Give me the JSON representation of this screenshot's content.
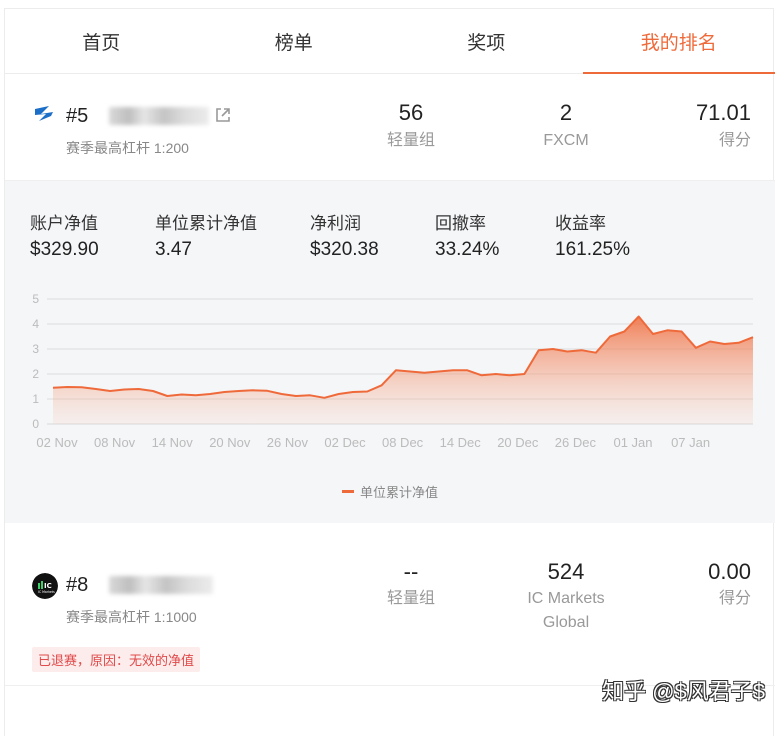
{
  "tabs": [
    "首页",
    "榜单",
    "奖项",
    "我的排名"
  ],
  "entries": [
    {
      "rank": "#5",
      "leverage": "赛季最高杠杆 1:200",
      "stats": [
        {
          "value": "56",
          "label": "轻量组"
        },
        {
          "value": "2",
          "label": "FXCM"
        },
        {
          "value": "71.01",
          "label": "得分"
        }
      ]
    },
    {
      "rank": "#8",
      "leverage": "赛季最高杠杆 1:1000",
      "stats": [
        {
          "value": "--",
          "label": "轻量组"
        },
        {
          "value": "524",
          "label": "IC Markets\nGlobal"
        },
        {
          "value": "0.00",
          "label": "得分"
        }
      ],
      "status_badge": "已退赛，原因：无效的净值",
      "logo_text": "IC Markets"
    }
  ],
  "metrics": [
    {
      "label": "账户净值",
      "value": "$329.90"
    },
    {
      "label": "单位累计净值",
      "value": "3.47"
    },
    {
      "label": "净利润",
      "value": "$320.38"
    },
    {
      "label": "回撤率",
      "value": "33.24%"
    },
    {
      "label": "收益率",
      "value": "161.25%"
    }
  ],
  "chart_data": {
    "type": "area",
    "x": [
      "02 Nov",
      "08 Nov",
      "14 Nov",
      "20 Nov",
      "26 Nov",
      "02 Dec",
      "08 Dec",
      "14 Dec",
      "20 Dec",
      "26 Dec",
      "01 Jan",
      "07 Jan"
    ],
    "ylim": [
      0,
      5
    ],
    "yticks": [
      0,
      1,
      2,
      3,
      4,
      5
    ],
    "series": [
      {
        "name": "单位累计净值",
        "values": [
          1.45,
          1.48,
          1.47,
          1.4,
          1.32,
          1.38,
          1.4,
          1.32,
          1.12,
          1.18,
          1.15,
          1.2,
          1.28,
          1.32,
          1.35,
          1.33,
          1.2,
          1.12,
          1.15,
          1.05,
          1.2,
          1.28,
          1.3,
          1.55,
          2.15,
          2.1,
          2.05,
          2.1,
          2.15,
          2.15,
          1.95,
          2.0,
          1.95,
          2.0,
          2.95,
          3.0,
          2.9,
          2.95,
          2.85,
          3.5,
          3.7,
          4.3,
          3.6,
          3.75,
          3.7,
          3.05,
          3.3,
          3.2,
          3.25,
          3.47
        ]
      }
    ],
    "legend": "bottom",
    "color": "#ef6a3a",
    "grid": true
  },
  "watermark": "知乎 @$风君子$"
}
